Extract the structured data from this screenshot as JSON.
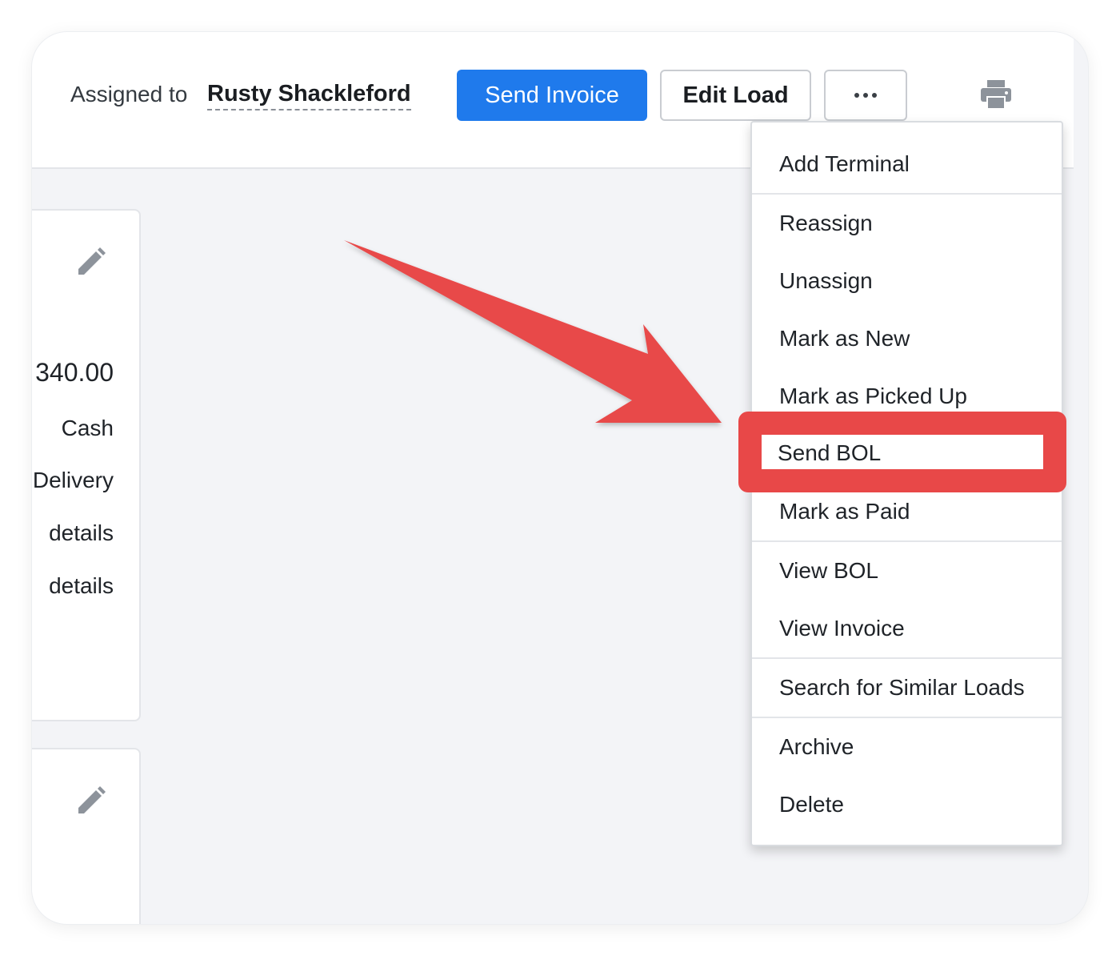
{
  "header": {
    "assigned_label": "Assigned to",
    "assignee": "Rusty Shackleford",
    "send_invoice_label": "Send Invoice",
    "edit_load_label": "Edit Load",
    "more_icon": "more-horizontal-icon",
    "print_icon": "printer-icon"
  },
  "cards": {
    "amount": "340.00",
    "payment": "Cash",
    "delivery": "Delivery",
    "details_1": "details",
    "details_2": "details",
    "edit_icon": "pencil-icon"
  },
  "menu": {
    "items": [
      "Add Terminal",
      "Reassign",
      "Unassign",
      "Mark as New",
      "Mark as Picked Up",
      "Send BOL",
      "Mark as Paid",
      "View BOL",
      "View Invoice",
      "Search for Similar Loads",
      "Archive",
      "Delete"
    ],
    "highlighted": "Send BOL"
  },
  "annotation": {
    "arrow_color": "#e84848",
    "highlight_color": "#e84848"
  },
  "colors": {
    "primary": "#1f7aec",
    "background": "#f3f4f7"
  }
}
